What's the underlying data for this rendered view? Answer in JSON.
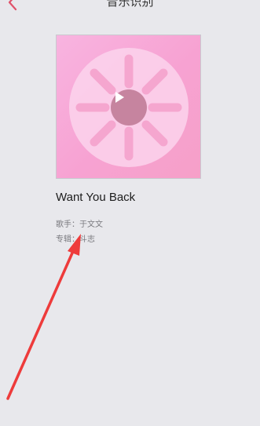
{
  "header": {
    "title": "音乐识别"
  },
  "song": {
    "title": "Want You Back",
    "artist_label": "歌手：",
    "artist": "于文文",
    "album_label": "专辑：",
    "album": "斗志"
  },
  "colors": {
    "accent": "#e0526a",
    "cover_pink": "#f7a2d2",
    "arrow_red": "#ee3b3b"
  }
}
